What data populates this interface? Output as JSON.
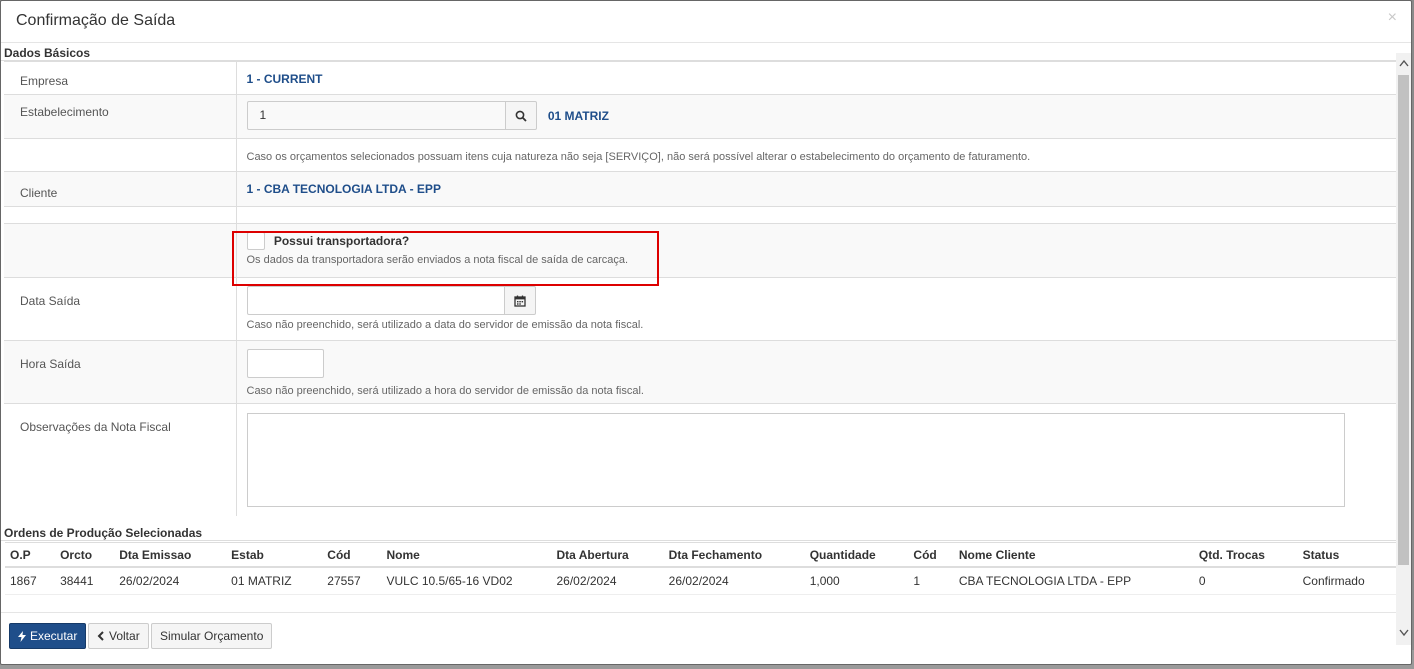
{
  "modal": {
    "title": "Confirmação de Saída",
    "close": "×"
  },
  "sections": {
    "basic": "Dados Básicos",
    "orders": "Ordens de Produção Selecionadas"
  },
  "form": {
    "empresa_label": "Empresa",
    "empresa_value": "1 - CURRENT",
    "estab_label": "Estabelecimento",
    "estab_input": "1",
    "estab_value": "01 MATRIZ",
    "estab_note": "Caso os orçamentos selecionados possuam itens cuja natureza não seja [SERVIÇO], não será possível alterar o estabelecimento do orçamento de faturamento.",
    "cliente_label": "Cliente",
    "cliente_value": "1 - CBA TECNOLOGIA LTDA - EPP",
    "transp_label": "Possui transportadora?",
    "transp_help": "Os dados da transportadora serão enviados a nota fiscal de saída de carcaça.",
    "data_label": "Data Saída",
    "data_value": "",
    "data_help": "Caso não preenchido, será utilizado a data do servidor de emissão da nota fiscal.",
    "hora_label": "Hora Saída",
    "hora_value": "",
    "hora_help": "Caso não preenchido, será utilizado a hora do servidor de emissão da nota fiscal.",
    "obs_label": "Observações da Nota Fiscal",
    "obs_value": ""
  },
  "orders": {
    "columns": [
      "O.P",
      "Orcto",
      "Dta Emissao",
      "Estab",
      "Cód",
      "Nome",
      "Dta Abertura",
      "Dta Fechamento",
      "Quantidade",
      "Cód",
      "Nome Cliente",
      "Qtd. Trocas",
      "Status"
    ],
    "rows": [
      [
        "1867",
        "38441",
        "26/02/2024",
        "01 MATRIZ",
        "27557",
        "VULC 10.5/65-16 VD02",
        "26/02/2024",
        "26/02/2024",
        "1,000",
        "1",
        "CBA TECNOLOGIA LTDA - EPP",
        "0",
        "Confirmado"
      ]
    ]
  },
  "footer": {
    "execute": "Executar",
    "back": "Voltar",
    "simulate": "Simular Orçamento"
  },
  "colors": {
    "primary": "#1f4e8a",
    "highlight": "#dd0000"
  }
}
